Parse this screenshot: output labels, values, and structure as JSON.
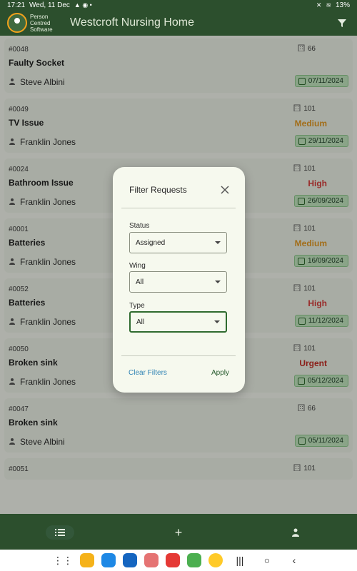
{
  "status_bar": {
    "time": "17:21",
    "date": "Wed, 11 Dec",
    "battery": "13%"
  },
  "app_bar": {
    "logo_lines": [
      "Person",
      "Centred",
      "Software"
    ],
    "title": "Westcroft Nursing Home",
    "filter_icon": "filter-icon"
  },
  "requests": [
    {
      "id": "#0048",
      "title": "Faulty Socket",
      "person": "Steve Albini",
      "room": "66",
      "priority": "",
      "date": "07/11/2024"
    },
    {
      "id": "#0049",
      "title": "TV Issue",
      "person": "Franklin Jones",
      "room": "101",
      "priority": "Medium",
      "date": "29/11/2024"
    },
    {
      "id": "#0024",
      "title": "Bathroom Issue",
      "person": "Franklin Jones",
      "room": "101",
      "priority": "High",
      "date": "26/09/2024"
    },
    {
      "id": "#0001",
      "title": "Batteries",
      "person": "Franklin Jones",
      "room": "101",
      "priority": "Medium",
      "date": "16/09/2024"
    },
    {
      "id": "#0052",
      "title": "Batteries",
      "person": "Franklin Jones",
      "room": "101",
      "priority": "High",
      "date": "11/12/2024"
    },
    {
      "id": "#0050",
      "title": "Broken sink",
      "person": "Franklin Jones",
      "room": "101",
      "priority": "Urgent",
      "date": "05/12/2024"
    },
    {
      "id": "#0047",
      "title": "Broken sink",
      "person": "Steve Albini",
      "room": "66",
      "priority": "",
      "date": "05/11/2024"
    },
    {
      "id": "#0051",
      "title": "",
      "person": "",
      "room": "101",
      "priority": "",
      "date": ""
    }
  ],
  "filter_dialog": {
    "title": "Filter Requests",
    "status": {
      "label": "Status",
      "value": "Assigned"
    },
    "wing": {
      "label": "Wing",
      "value": "All"
    },
    "type": {
      "label": "Type",
      "value": "All"
    },
    "clear_label": "Clear Filters",
    "apply_label": "Apply"
  },
  "colors": {
    "primary": "#2c4f2d",
    "medium": "#e19823",
    "high": "#d43b39",
    "urgent": "#c12a22",
    "date_bg": "#bfe3bd"
  }
}
